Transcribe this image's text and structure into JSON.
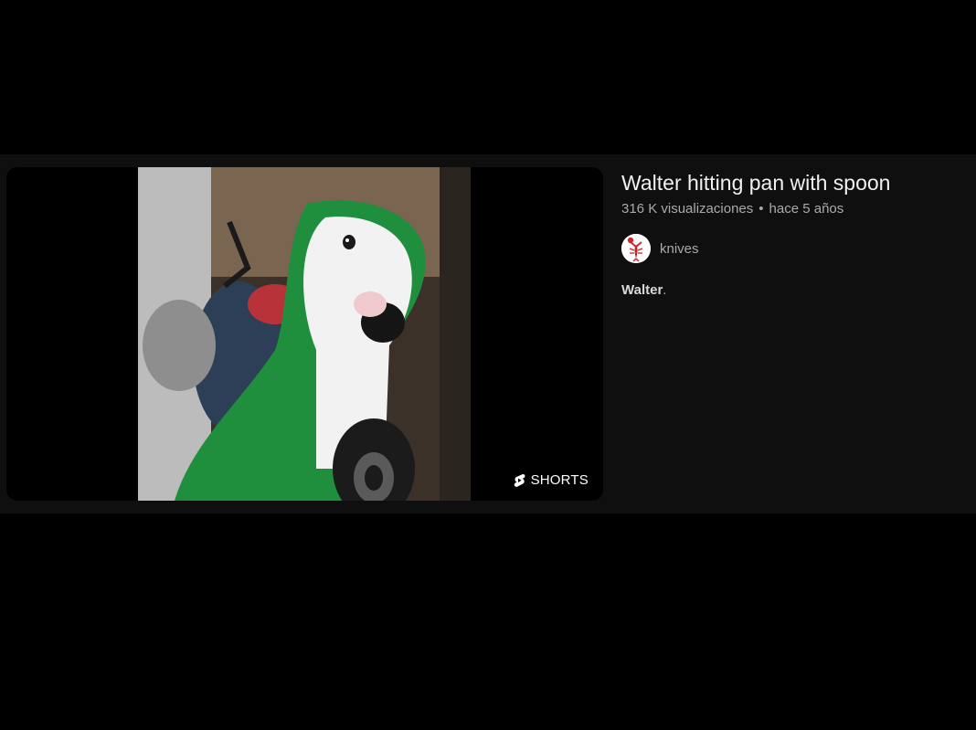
{
  "result": {
    "title": "Walter hitting pan with spoon",
    "views": "316 K visualizaciones",
    "separator": "•",
    "published": "hace 5 años",
    "channel": {
      "name": "knives",
      "avatar_icon": "crawfish-avatar-icon"
    },
    "description": {
      "bold": "Walter",
      "rest": "."
    },
    "badge": {
      "label": "SHORTS",
      "icon": "shorts-icon"
    },
    "thumbnail": {
      "subject": "bull-terrier-in-green-hood"
    }
  },
  "colors": {
    "page_background": "#000000",
    "card_background": "#0f0f0f",
    "title_text": "#f1f1f1",
    "secondary_text": "#aaaaaa",
    "hood_green": "#1f8f3e"
  }
}
